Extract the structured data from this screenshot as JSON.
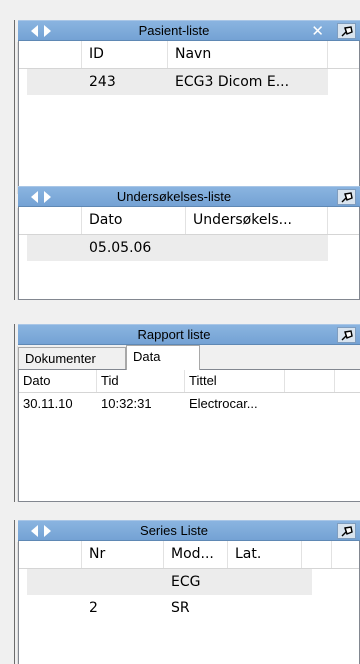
{
  "panels": {
    "patients": {
      "title": "Pasient-liste",
      "columns": [
        "ID",
        "Navn"
      ],
      "rows": [
        {
          "id": "243",
          "name": "ECG3 Dicom E..."
        }
      ]
    },
    "exams": {
      "title": "Undersøkelses-liste",
      "columns": [
        "Dato",
        "Undersøkels..."
      ],
      "rows": [
        {
          "date": "05.05.06"
        }
      ]
    },
    "report": {
      "title": "Rapport liste",
      "tabs": [
        "Dokumenter",
        "Data"
      ],
      "active_tab": "Data",
      "columns": [
        "Dato",
        "Tid",
        "Tittel"
      ],
      "rows": [
        {
          "date": "30.11.10",
          "time": "10:32:31",
          "title": "Electrocar..."
        }
      ]
    },
    "series": {
      "title": "Series Liste",
      "columns": [
        "Nr",
        "Mod...",
        "Lat."
      ],
      "rows": [
        {
          "nr": "",
          "mod": "ECG"
        },
        {
          "nr": "2",
          "mod": "SR"
        }
      ]
    }
  },
  "icons": {
    "nav": "left-right-arrows-icon",
    "close": "close-icon",
    "pin": "pin-icon"
  },
  "colors": {
    "titlebar": "#7aa7d8",
    "row_alt": "#ececec"
  }
}
